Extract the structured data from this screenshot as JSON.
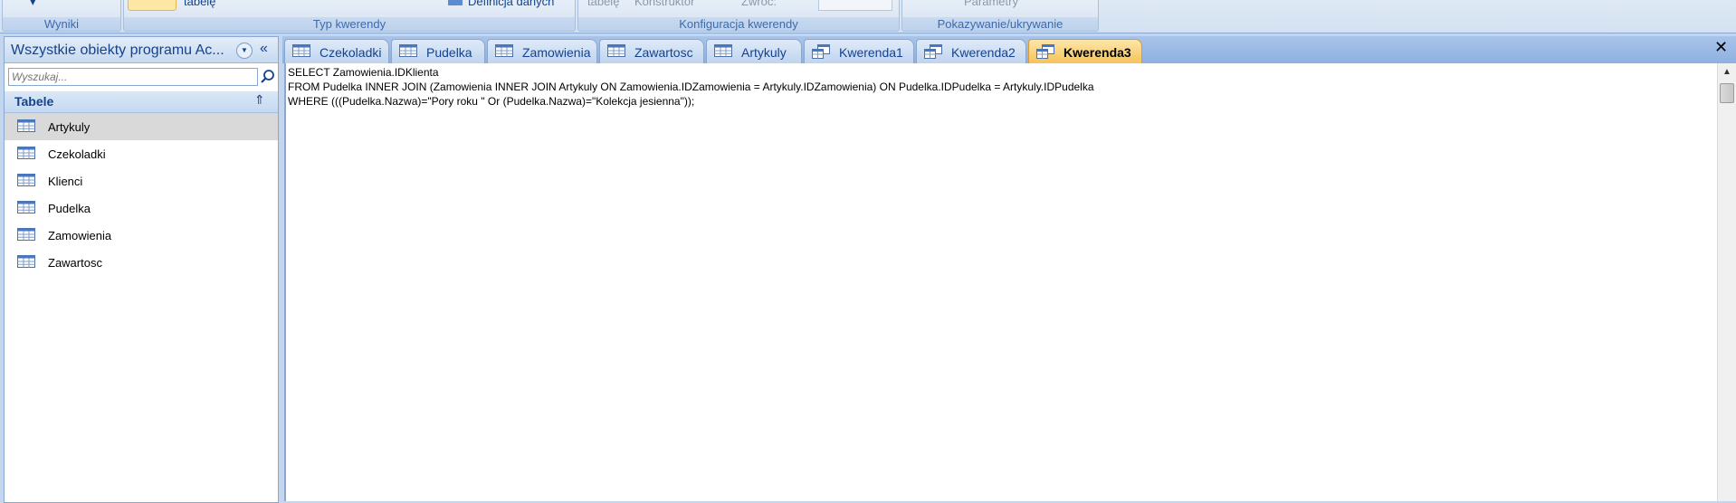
{
  "ribbon": {
    "groups": [
      {
        "title": "Wyniki"
      },
      {
        "title": "Typ kwerendy",
        "items": [
          "tabelę",
          "Definicja danych"
        ]
      },
      {
        "title": "Konfiguracja kwerendy",
        "items": [
          "tabelę",
          "Konstruktor",
          "Zwróć:"
        ]
      },
      {
        "title": "Pokazywanie/ukrywanie",
        "items": [
          "Parametry"
        ]
      }
    ]
  },
  "nav": {
    "title": "Wszystkie obiekty programu Ac...",
    "search_placeholder": "Wyszukaj...",
    "group_label": "Tabele",
    "items": [
      {
        "label": "Artykuly",
        "selected": true
      },
      {
        "label": "Czekoladki"
      },
      {
        "label": "Klienci"
      },
      {
        "label": "Pudelka"
      },
      {
        "label": "Zamowienia"
      },
      {
        "label": "Zawartosc"
      }
    ]
  },
  "tabs": [
    {
      "label": "Czekoladki",
      "icon": "table-icon"
    },
    {
      "label": "Pudelka",
      "icon": "table-icon"
    },
    {
      "label": "Zamowienia",
      "icon": "table-icon"
    },
    {
      "label": "Zawartosc",
      "icon": "table-icon"
    },
    {
      "label": "Artykuly",
      "icon": "table-icon"
    },
    {
      "label": "Kwerenda1",
      "icon": "query-icon"
    },
    {
      "label": "Kwerenda2",
      "icon": "query-icon"
    },
    {
      "label": "Kwerenda3",
      "icon": "query-icon",
      "active": true
    }
  ],
  "editor": {
    "sql_lines": [
      "SELECT Zamowienia.IDKlienta",
      "FROM Pudelka INNER JOIN (Zamowienia INNER JOIN Artykuly ON Zamowienia.IDZamowienia = Artykuly.IDZamowienia) ON Pudelka.IDPudelka = Artykuly.IDPudelka",
      "WHERE (((Pudelka.Nazwa)=\"Pory roku \" Or (Pudelka.Nazwa)=\"Kolekcja jesienna\"));"
    ]
  },
  "close_symbol": "✕",
  "colors": {
    "accent": "#15428b",
    "active_tab": "#f6c35a",
    "chrome": "#c3d6ee"
  }
}
